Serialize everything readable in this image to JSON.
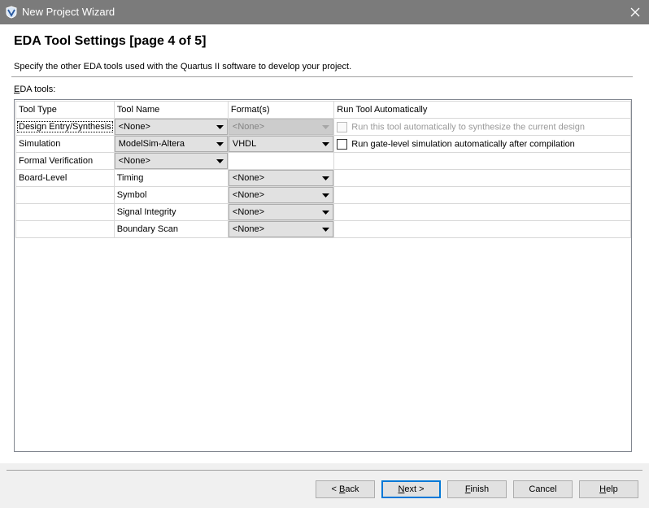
{
  "window": {
    "title": "New Project Wizard",
    "icon": "quartus-app-icon",
    "close_icon": "close-icon"
  },
  "header": {
    "title": "EDA Tool Settings [page 4 of 5]",
    "description": "Specify the other EDA tools used with the Quartus II software to develop your project."
  },
  "eda": {
    "label": "EDA tools:",
    "columns": [
      "Tool Type",
      "Tool Name",
      "Format(s)",
      "Run Tool Automatically"
    ],
    "rows": {
      "design_entry": {
        "type": "Design Entry/Synthesis",
        "tool": "<None>",
        "format": "<None>",
        "run_label": "Run this tool automatically to synthesize the current design",
        "run_checked": false,
        "run_enabled": false
      },
      "simulation": {
        "type": "Simulation",
        "tool": "ModelSim-Altera",
        "format": "VHDL",
        "run_label": "Run gate-level simulation automatically after compilation",
        "run_checked": false,
        "run_enabled": true
      },
      "formal": {
        "type": "Formal Verification",
        "tool": "<None>"
      },
      "board": {
        "type": "Board-Level",
        "items": [
          {
            "name": "Timing",
            "format": "<None>"
          },
          {
            "name": "Symbol",
            "format": "<None>"
          },
          {
            "name": "Signal Integrity",
            "format": "<None>"
          },
          {
            "name": "Boundary Scan",
            "format": "<None>"
          }
        ]
      }
    }
  },
  "footer": {
    "back": {
      "pre": "< ",
      "key": "B",
      "post": "ack"
    },
    "next": {
      "pre": "",
      "key": "N",
      "post": "ext >"
    },
    "finish": {
      "pre": "",
      "key": "F",
      "post": "inish"
    },
    "cancel": {
      "pre": "Cancel",
      "key": "",
      "post": ""
    },
    "help": {
      "pre": "",
      "key": "H",
      "post": "elp"
    }
  },
  "colors": {
    "titlebar": "#7b7b7b",
    "dialog_bg": "#f0f0f0",
    "accent_focus": "#0078d7"
  }
}
